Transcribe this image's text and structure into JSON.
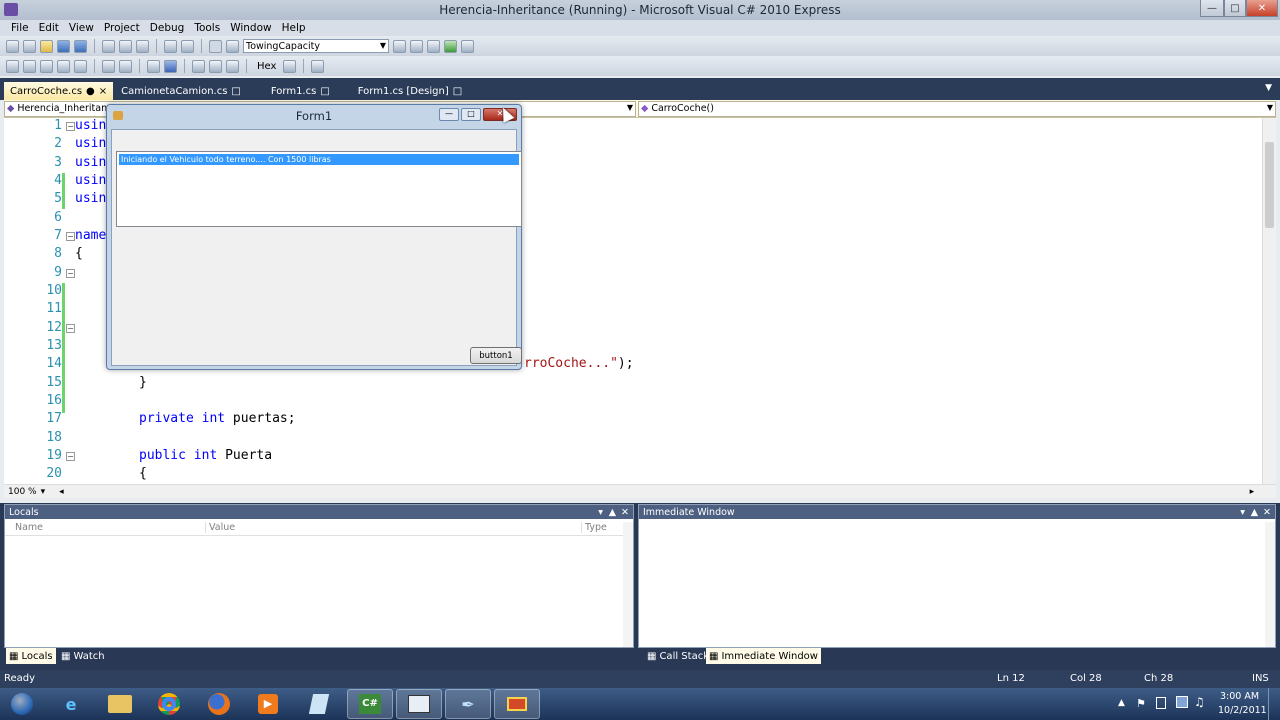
{
  "window": {
    "title": "Herencia-Inheritance (Running) - Microsoft Visual C# 2010 Express"
  },
  "menu": [
    "File",
    "Edit",
    "View",
    "Project",
    "Debug",
    "Tools",
    "Window",
    "Help"
  ],
  "toolbar": {
    "combo_value": "TowingCapacity",
    "hex_label": "Hex"
  },
  "tabs": [
    {
      "label": "CarroCoche.cs",
      "active": true
    },
    {
      "label": "CamionetaCamion.cs",
      "active": false
    },
    {
      "label": "Form1.cs",
      "active": false
    },
    {
      "label": "Form1.cs [Design]",
      "active": false
    }
  ],
  "navbar": {
    "left": "Herencia_Inheritance",
    "right": "CarroCoche()"
  },
  "editor": {
    "zoom": "100 %",
    "line_numbers": [
      "1",
      "2",
      "3",
      "4",
      "5",
      "6",
      "7",
      "8",
      "9",
      "10",
      "11",
      "12",
      "13",
      "14",
      "15",
      "16",
      "17",
      "18",
      "19",
      "20"
    ],
    "visible_code": {
      "l1": "usin",
      "l2": "usin",
      "l3": "usin",
      "l4": "usin",
      "l5": "usin",
      "l7": "name",
      "l8": "{",
      "l14_str": "rroCoche...\"",
      "l14_tail": ");",
      "l15": "}",
      "l17_kw1": "private",
      "l17_kw2": "int",
      "l17_rest": " puertas;",
      "l19_kw1": "public",
      "l19_kw2": "int",
      "l19_rest": " Puerta",
      "l20": "{"
    }
  },
  "form1": {
    "title": "Form1",
    "list_item": "Iniciando el Vehiculo todo terreno.... Con 1500 libras",
    "button_label": "button1"
  },
  "locals": {
    "title": "Locals",
    "columns": [
      "Name",
      "Value",
      "Type"
    ]
  },
  "immediate": {
    "title": "Immediate Window"
  },
  "bottom_tabs_left": [
    "Locals",
    "Watch"
  ],
  "bottom_tabs_right": [
    "Call Stack",
    "Immediate Window"
  ],
  "status": {
    "ready": "Ready",
    "ln": "Ln 12",
    "col": "Col 28",
    "ch": "Ch 28",
    "ins": "INS"
  },
  "clock": {
    "time": "3:00 AM",
    "date": "10/2/2011"
  }
}
